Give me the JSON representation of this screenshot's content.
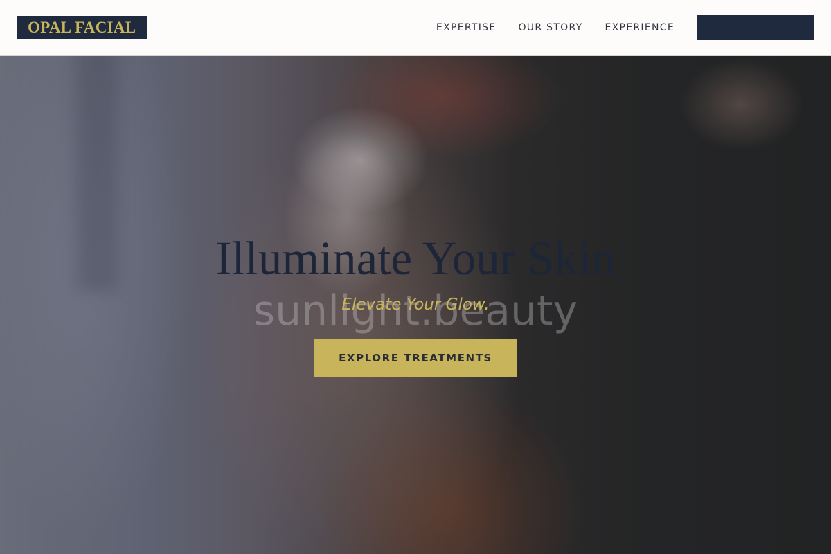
{
  "brand": {
    "logo_text": "OPAL FACIAL"
  },
  "nav": {
    "items": [
      {
        "label": "EXPERTISE"
      },
      {
        "label": "OUR STORY"
      },
      {
        "label": "EXPERIENCE"
      }
    ],
    "cta_label": ""
  },
  "hero": {
    "title": "Illuminate Your Skin",
    "subtitle": "Elevate Your Glow.",
    "watermark": "sunlight.beauty",
    "cta_label": "EXPLORE TREATMENTS"
  },
  "colors": {
    "navy": "#1f2a3f",
    "gold": "#c8b45a",
    "header_bg": "#fdfcfa"
  }
}
